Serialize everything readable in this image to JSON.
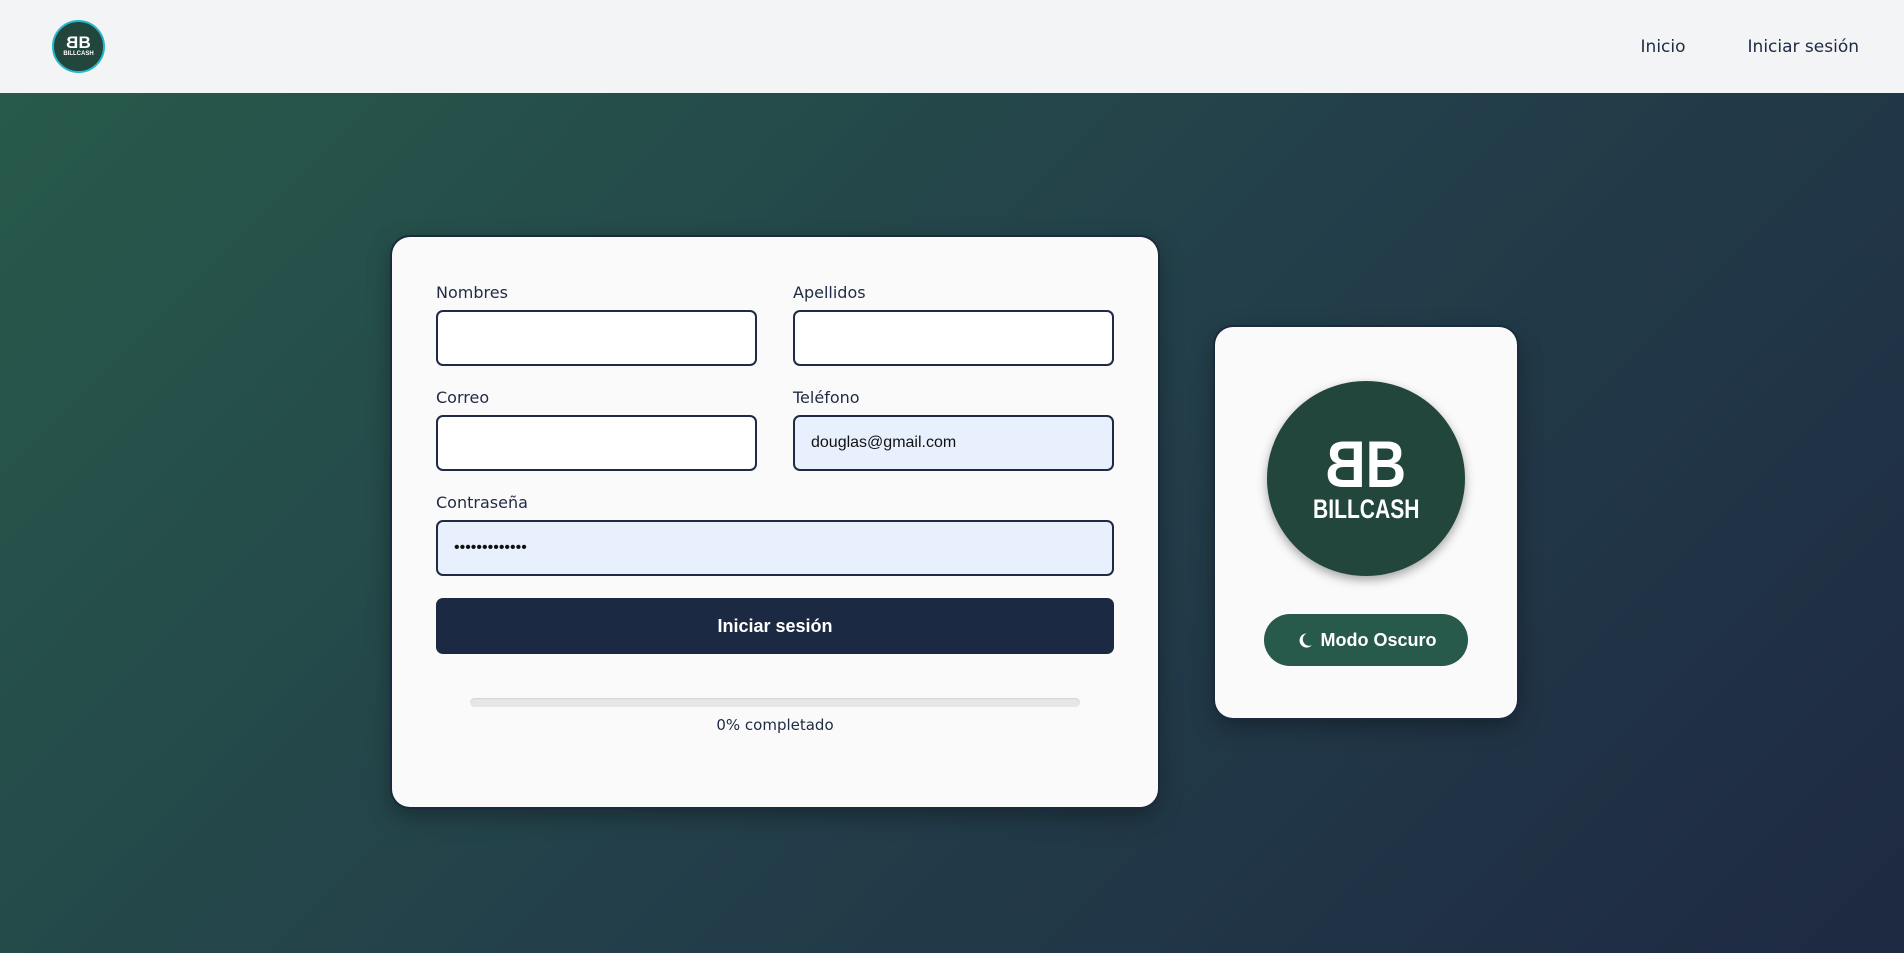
{
  "header": {
    "logo": {
      "letters": "BB",
      "wordmark": "BILLCASH"
    },
    "nav": [
      {
        "label": "Inicio"
      },
      {
        "label": "Iniciar sesión"
      }
    ]
  },
  "form": {
    "fields": {
      "nombres": {
        "label": "Nombres",
        "value": ""
      },
      "apellidos": {
        "label": "Apellidos",
        "value": ""
      },
      "correo": {
        "label": "Correo",
        "value": ""
      },
      "telefono": {
        "label": "Teléfono",
        "value": "douglas@gmail.com"
      },
      "contrasena": {
        "label": "Contraseña",
        "value": "•••••••••••••"
      }
    },
    "submit_label": "Iniciar sesión",
    "progress": {
      "percent": 0,
      "text": "0% completado"
    }
  },
  "brand": {
    "letters": "BB",
    "wordmark": "BILLCASH",
    "dark_mode_label": "Modo Oscuro",
    "dark_mode_icon": "moon-icon"
  },
  "colors": {
    "primary_dark": "#1c2942",
    "brand_green": "#275a4a",
    "logo_ring": "#22b8cf",
    "autofill_bg": "#e8f0fd"
  }
}
